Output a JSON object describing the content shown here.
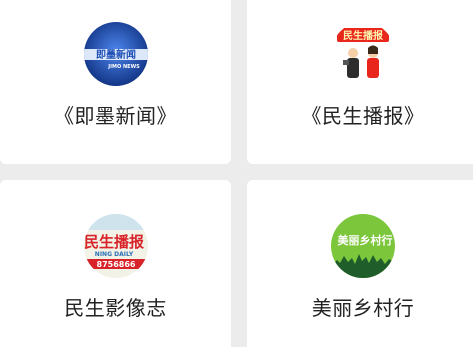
{
  "programs": [
    {
      "title": "《即墨新闻》",
      "logo": {
        "icon": "jimo-news-logo-icon",
        "text_main": "即墨新闻",
        "text_sub": "JIMO NEWS",
        "colors": {
          "bg": "#1e4fb5",
          "accent": "#e8f0ff"
        }
      }
    },
    {
      "title": "《民生播报》",
      "logo": {
        "icon": "minsheng-bobao-logo-icon",
        "text_main": "民生播报",
        "colors": {
          "bg": "#ffffff",
          "accent": "#e8261c"
        }
      }
    },
    {
      "title": "民生影像志",
      "logo": {
        "icon": "minsheng-yingxiangzhi-logo-icon",
        "text_main": "民生播报",
        "text_sub": "NING DAILY",
        "text_num": "8756866",
        "colors": {
          "bg": "#f2f2e6",
          "accent": "#d8232a"
        }
      }
    },
    {
      "title": "美丽乡村行",
      "logo": {
        "icon": "meili-xiangcun-logo-icon",
        "text_main": "美丽乡村行",
        "colors": {
          "bg": "#7cc63b",
          "accent": "#ffffff"
        }
      }
    }
  ]
}
